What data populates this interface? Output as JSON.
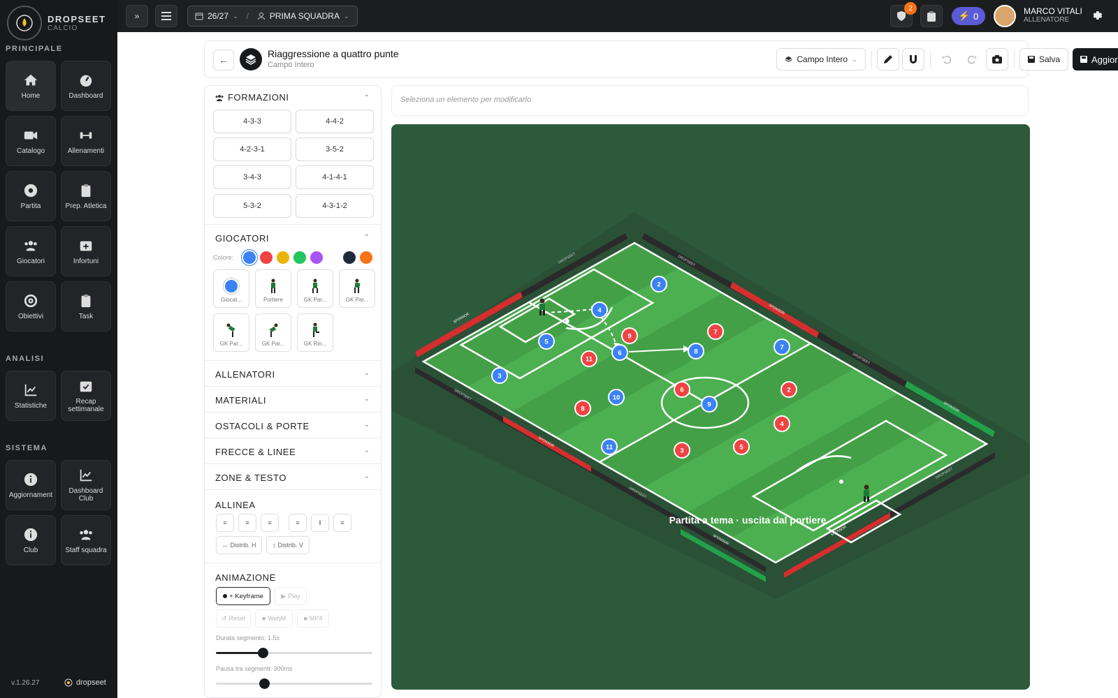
{
  "brand": {
    "name": "DROPSEET",
    "sub": "CALCIO"
  },
  "sidebar": {
    "sections": [
      {
        "label": "PRINCIPALE"
      },
      {
        "label": "ANALISI"
      },
      {
        "label": "SISTEMA"
      }
    ],
    "items": [
      {
        "label": "Home",
        "icon": "home-icon"
      },
      {
        "label": "Dashboard",
        "icon": "gauge-icon"
      },
      {
        "label": "Catalogo",
        "icon": "video-icon"
      },
      {
        "label": "Allenamenti",
        "icon": "dumbbell-icon"
      },
      {
        "label": "Partita",
        "icon": "ball-icon"
      },
      {
        "label": "Prep. Atletica",
        "icon": "clipboard-icon"
      },
      {
        "label": "Giocatori",
        "icon": "users-icon"
      },
      {
        "label": "Infortuni",
        "icon": "medkit-icon"
      },
      {
        "label": "Obiettivi",
        "icon": "target-icon"
      },
      {
        "label": "Task",
        "icon": "clipboard-icon"
      },
      {
        "label": "Statistiche",
        "icon": "chart-icon"
      },
      {
        "label": "Recap settimanale",
        "icon": "calendar-check-icon"
      },
      {
        "label": "Aggiornament",
        "icon": "info-icon"
      },
      {
        "label": "Dashboard Club",
        "icon": "chart-icon"
      },
      {
        "label": "Club",
        "icon": "info-icon"
      },
      {
        "label": "Staff squadra",
        "icon": "users-icon"
      }
    ],
    "version": "v.1.26.27",
    "footer_brand": "dropseet"
  },
  "topbar": {
    "expand_label": "»",
    "season": "26/27",
    "separator": "/",
    "team": "PRIMA SQUADRA",
    "notification_count": "2",
    "credits": "0",
    "user_name": "MARCO VITALI",
    "user_role": "ALLENATORE"
  },
  "header": {
    "back": "←",
    "title": "Riaggressione a quattro punte",
    "subtitle": "Campo Intero",
    "field_select": "Campo Intero",
    "save": "Salva",
    "update": "Aggiorna"
  },
  "property_hint": "Seleziona un elemento per modificarlo",
  "panel": {
    "formazioni": {
      "title": "FORMAZIONI",
      "items": [
        "4-3-3",
        "4-4-2",
        "4-2-3-1",
        "3-5-2",
        "3-4-3",
        "4-1-4-1",
        "5-3-2",
        "4-3-1-2"
      ]
    },
    "giocatori": {
      "title": "GIOCATORI",
      "color_label": "Colore:",
      "colors": [
        "#3b82f6",
        "#ef4444",
        "#eab308",
        "#22c55e",
        "#a855f7",
        "#1e293b",
        "#f97316"
      ],
      "tiles": [
        "Giocat...",
        "Portiere",
        "GK Par...",
        "GK Par...",
        "GK Par...",
        "GK Par...",
        "GK Rin..."
      ]
    },
    "collapsed": [
      "ALLENATORI",
      "MATERIALI",
      "OSTACOLI & PORTE",
      "FRECCE & LINEE",
      "ZONE & TESTO"
    ],
    "allinea": {
      "title": "ALLINEA",
      "distrib_h": "Distrib. H",
      "distrib_v": "Distrib. V"
    },
    "animazione": {
      "title": "ANIMAZIONE",
      "keyframe": "+ Keyframe",
      "play": "Play",
      "reset": "Reset",
      "webm": "WebM",
      "mp4": "MP4",
      "segment_label": "Durata segmento: 1.5s",
      "segment_value": 0.3,
      "pause_label": "Pausa tra segmenti: 300ms"
    }
  },
  "pitch": {
    "caption": "Partita a tema · uscita dal portiere",
    "ad_text": "DROPSEET",
    "ad_sponsor": "SPONSOR",
    "blue_players": [
      "2",
      "4",
      "5",
      "3",
      "6",
      "8",
      "7",
      "10",
      "9",
      "11"
    ],
    "red_players": [
      "9",
      "7",
      "11",
      "6",
      "2",
      "8",
      "4",
      "3",
      "5"
    ]
  }
}
